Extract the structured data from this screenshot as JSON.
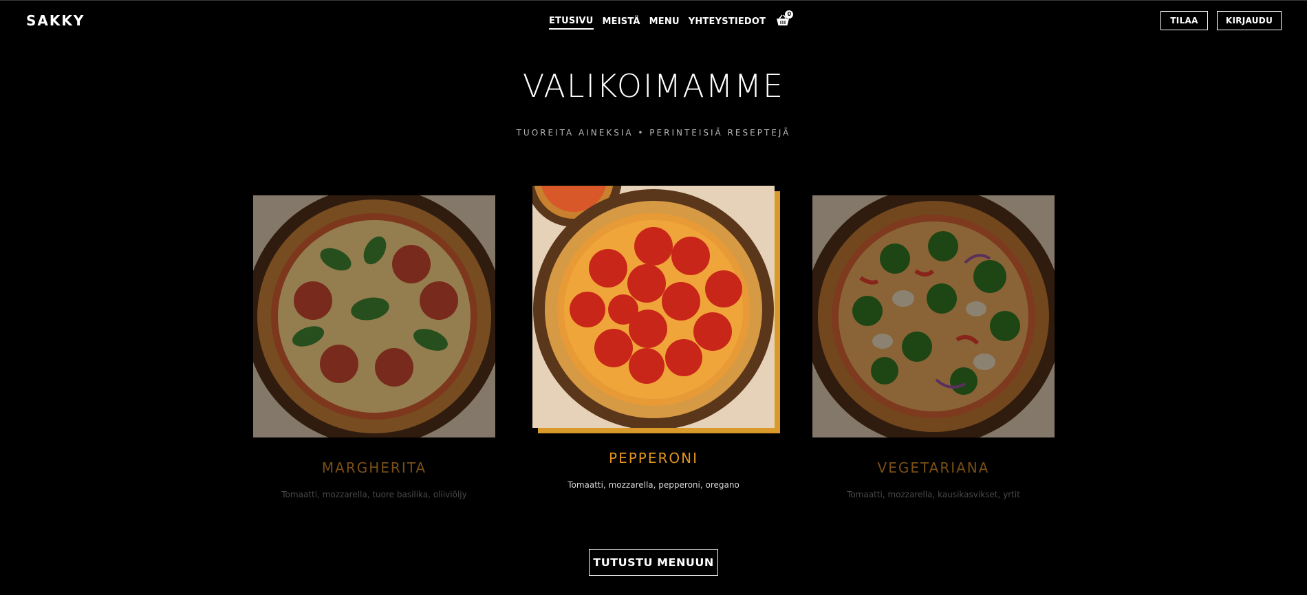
{
  "header": {
    "logo": "SAKKY",
    "nav": [
      "ETUSIVU",
      "MEISTÄ",
      "MENU",
      "YHTEYSTIEDOT"
    ],
    "cart_count": "0",
    "order_label": "TILAA",
    "login_label": "KIRJAUDU"
  },
  "hero": {
    "title": "VALIKOIMAMME",
    "subtitle": "TUOREITA AINEKSIA • PERINTEISIÄ RESEPTEJÄ"
  },
  "pizzas": [
    {
      "name": "MARGHERITA",
      "desc": "Tomaatti, mozzarella, tuore basilika, oliiviöljy"
    },
    {
      "name": "PEPPERONI",
      "desc": "Tomaatti, mozzarella, pepperoni, oregano"
    },
    {
      "name": "VEGETARIANA",
      "desc": "Tomaatti, mozzarella, kausikasvikset, yrtit"
    }
  ],
  "cta_label": "TUTUSTU MENUUN",
  "colors": {
    "accent": "#e3941d",
    "background": "#000000"
  }
}
